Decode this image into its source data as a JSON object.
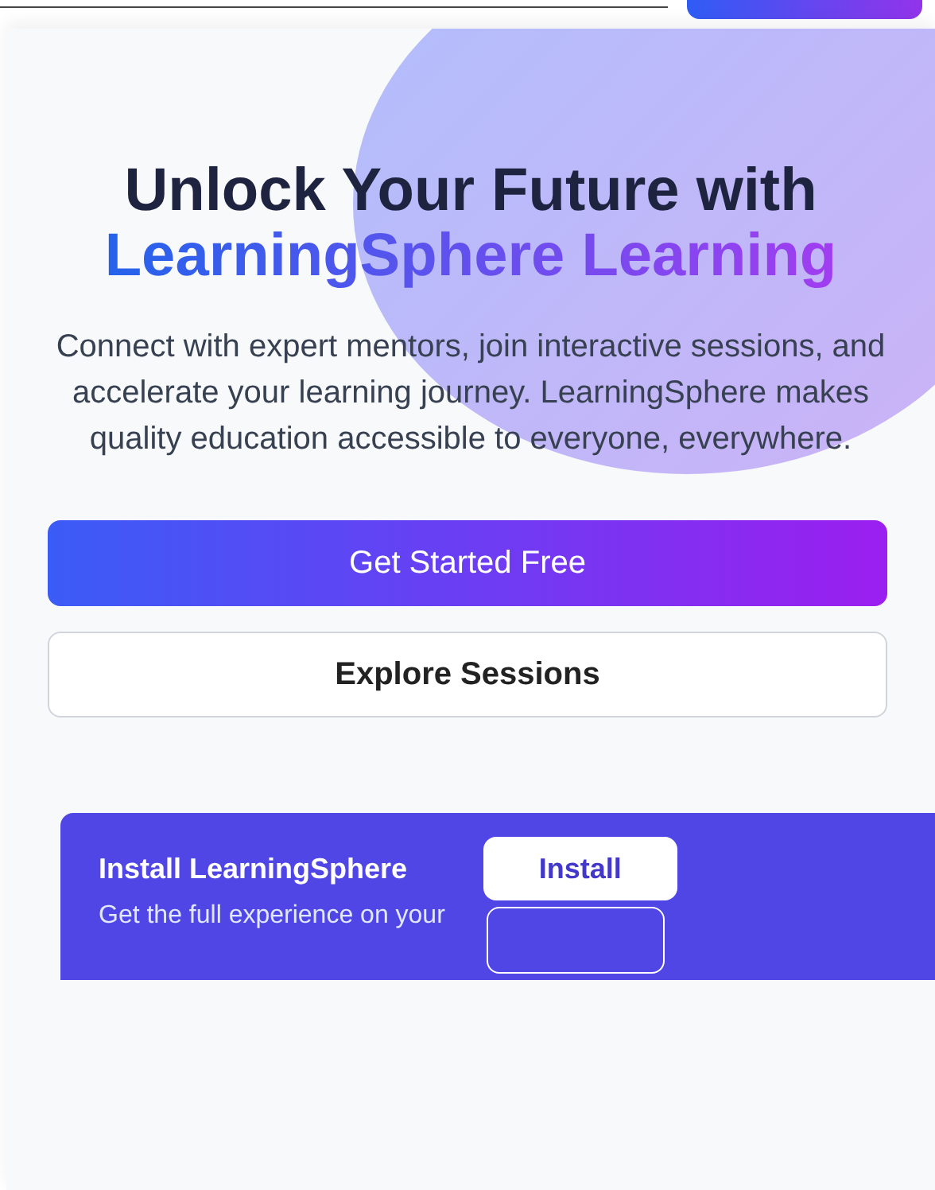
{
  "hero": {
    "title_lead": "Unlock Your Future with",
    "title_highlight": "LearningSphere Learning",
    "description": "Connect with expert mentors, join interactive sessions, and accelerate your learning journey. LearningSphere makes quality education accessible to everyone, everywhere."
  },
  "actions": [
    {
      "label": "Get Started Free",
      "kind": "primary"
    },
    {
      "label": "Explore Sessions",
      "kind": "secondary"
    }
  ],
  "install_banner": {
    "title": "Install LearningSphere",
    "text": "Get the full experience on your",
    "button": "Install"
  }
}
